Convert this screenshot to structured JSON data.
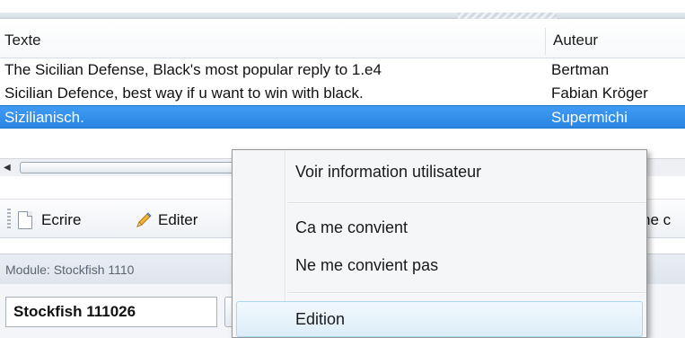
{
  "table": {
    "headers": [
      "Texte",
      "Auteur"
    ],
    "rows": [
      {
        "text": "The Sicilian Defense, Black's most popular reply to 1.e4",
        "author": "Bertman"
      },
      {
        "text": "Sicilian Defence, best way if u want to win with black.",
        "author": "Fabian Kröger"
      },
      {
        "text": "Sizilianisch.",
        "author": "Supermichi"
      }
    ],
    "selected_row_index": 2
  },
  "toolbar": {
    "write_label": "Ecrire",
    "edit_label": "Editer",
    "partial_label": "ne c"
  },
  "module_bar": {
    "label": "Module: Stockfish 1110"
  },
  "engine": {
    "tab_label": "Stockfish 111026"
  },
  "context_menu": {
    "items": [
      {
        "label": "Voir information utilisateur"
      },
      {
        "label": "Ca me convient"
      },
      {
        "label": "Ne me convient pas"
      },
      {
        "label": "Edition"
      }
    ],
    "hovered_index": 3
  },
  "colors": {
    "selection": "#2a86e2",
    "menu_background": "#f5f6f7",
    "hover_highlight": "#dcedf8"
  }
}
